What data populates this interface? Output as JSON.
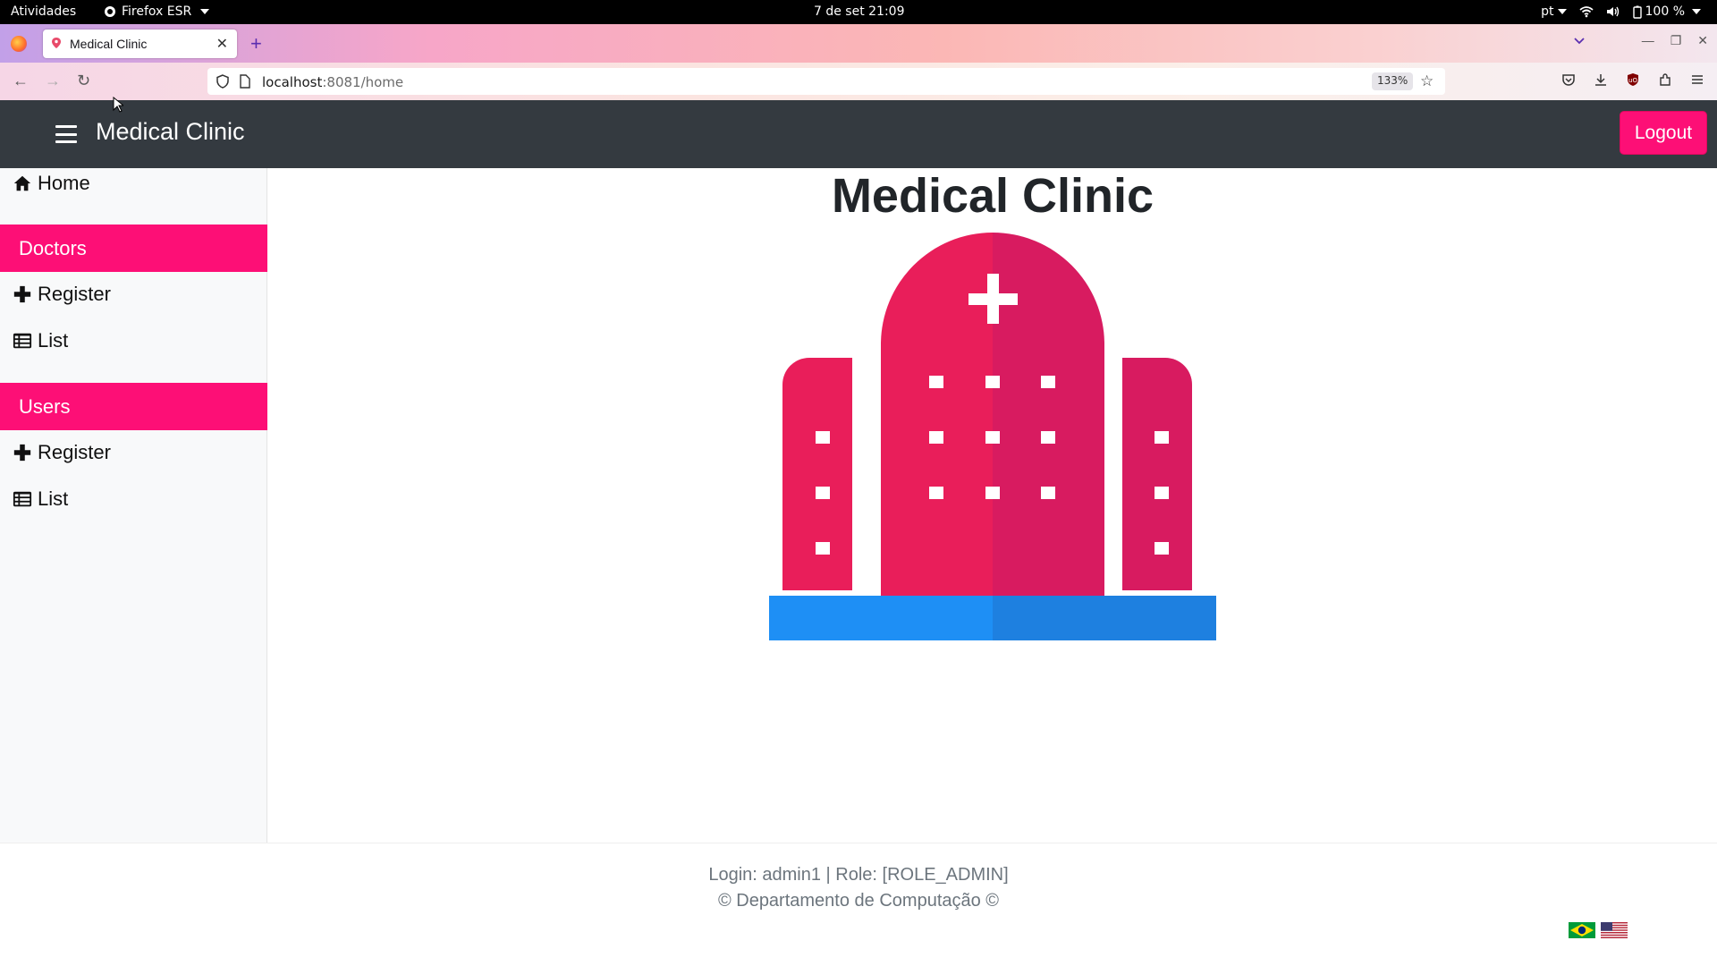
{
  "system_bar": {
    "activities": "Atividades",
    "app_name": "Firefox ESR",
    "clock": "7 de set  21:09",
    "language": "pt",
    "battery": "100 %"
  },
  "browser": {
    "tab_title": "Medical Clinic",
    "url_host": "localhost",
    "url_rest": ":8081/home",
    "zoom": "133%"
  },
  "app": {
    "brand": "Medical Clinic",
    "logout_label": "Logout"
  },
  "sidebar": {
    "home_label": "Home",
    "sections": [
      {
        "title": "Doctors",
        "items": [
          {
            "label": "Register",
            "icon": "plus-icon"
          },
          {
            "label": "List",
            "icon": "list-icon"
          }
        ]
      },
      {
        "title": "Users",
        "items": [
          {
            "label": "Register",
            "icon": "plus-icon"
          },
          {
            "label": "List",
            "icon": "list-icon"
          }
        ]
      }
    ]
  },
  "main": {
    "title": "Medical Clinic",
    "image": "hospital-illustration"
  },
  "footer": {
    "login_line": "Login: admin1 | Role: [ROLE_ADMIN]",
    "copyright_line": "© Departamento de Computação ©",
    "flags": [
      "brazil-flag",
      "usa-flag"
    ]
  },
  "colors": {
    "accent": "#fd0f76",
    "navbar": "#343a40",
    "hospital_light": "#e91e5a",
    "hospital_dark": "#d81b60",
    "ground_light": "#1e8ff5",
    "ground_dark": "#1e80e0"
  }
}
